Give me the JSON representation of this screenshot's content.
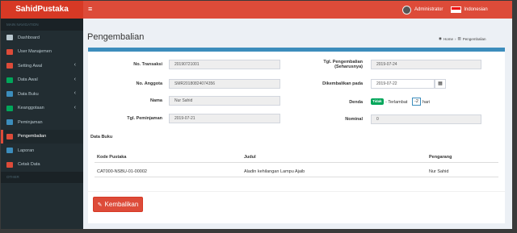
{
  "header": {
    "brand": "SahidPustaka",
    "menu_icon": "≡",
    "user": "Administrator",
    "language": "Indonesian"
  },
  "sidebar": {
    "section_label": "MAIN NAVIGATION",
    "items": [
      {
        "label": "Dashboard",
        "icon": "dashboard-icon",
        "color": "#b8c7ce"
      },
      {
        "label": "User Manajemen",
        "icon": "users-icon",
        "color": "#dd4b39"
      },
      {
        "label": "Setting Awal",
        "icon": "cogs-icon",
        "color": "#dd4b39",
        "chevron": true
      },
      {
        "label": "Data Awal",
        "icon": "gear-icon",
        "color": "#00a65a",
        "chevron": true
      },
      {
        "label": "Data Buku",
        "icon": "book-icon",
        "color": "#3c8dbc",
        "chevron": true
      },
      {
        "label": "Keanggotaan",
        "icon": "member-icon",
        "color": "#00a65a",
        "chevron": true
      },
      {
        "label": "Peminjaman",
        "icon": "loan-icon",
        "color": "#3c8dbc"
      },
      {
        "label": "Pengembalian",
        "icon": "return-icon",
        "color": "#dd4b39",
        "active": true
      },
      {
        "label": "Laporan",
        "icon": "chart-icon",
        "color": "#3c8dbc"
      },
      {
        "label": "Cetak Data",
        "icon": "printer-icon",
        "color": "#dd4b39"
      }
    ],
    "other_label": "OTHER"
  },
  "page": {
    "title": "Pengembalian",
    "crumb_home": "Home",
    "crumb_current": "Pengembalian"
  },
  "form": {
    "no_transaksi_label": "No. Transaksi",
    "no_transaksi_value": "20190721001",
    "no_anggota_label": "No. Anggota",
    "no_anggota_value": "SMR20180824074356",
    "nama_label": "Nama",
    "nama_value": "Nur Sahid",
    "tgl_pinjam_label": "Tgl. Peminjaman",
    "tgl_pinjam_value": "2019-07-21",
    "tgl_kembali_label_1": "Tgl. Pengembalian",
    "tgl_kembali_label_2": "(Seharusnya)",
    "tgl_kembali_value": "2019-07-24",
    "dikembalikan_label": "Dikembalikan pada",
    "dikembalikan_value": "2019-07-22",
    "denda_label": "Denda",
    "denda_badge": "Tidak",
    "denda_text": "- Terlambat",
    "denda_days": "-2",
    "denda_unit": "hari",
    "nominal_label": "Nominal",
    "nominal_value": "0"
  },
  "books": {
    "section_title": "Data Buku",
    "columns": [
      "Kode Pustaka",
      "Judul",
      "Pengarang"
    ],
    "rows": [
      {
        "kode": "CAT000-NSBU-01-00002",
        "judul": "Aladin kehilangan Lampu Ajaib",
        "pengarang": "Nur Sahid"
      }
    ]
  },
  "actions": {
    "submit_label": "Kembalikan"
  }
}
